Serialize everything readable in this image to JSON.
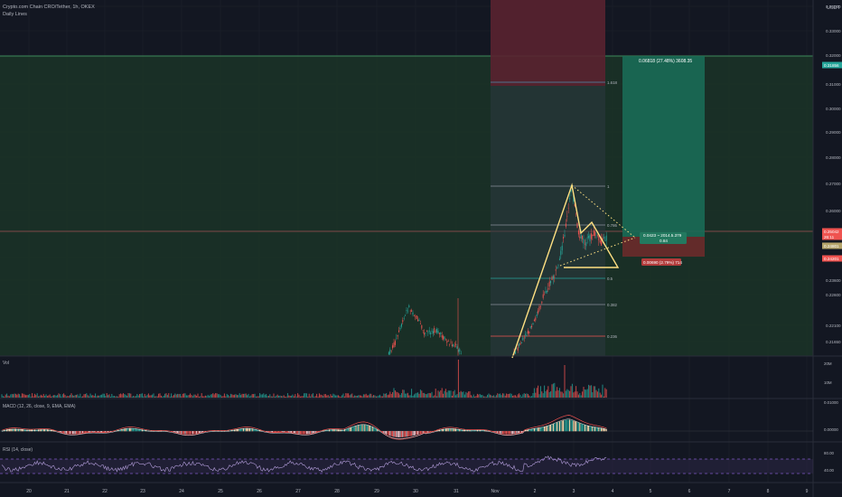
{
  "header": {
    "symbol_title": "Crypto.com Chain CRO/Tether, 1h, OKEX",
    "study_title": "Daily Lines",
    "currency": "USDT"
  },
  "panes": {
    "volume_title": "Vol",
    "macd_title": "MACD (12, 26, close, 9, EMA, EMA)",
    "rsi_title": "RSI (14, close)"
  },
  "chart_data": {
    "type": "candlestick",
    "symbol": "CRO/USDT",
    "timeframe": "1h",
    "exchange": "OKEX",
    "price_axis": {
      "ticks": [
        "0.34000",
        "0.33000",
        "0.32000",
        "0.31000",
        "0.30000",
        "0.29000",
        "0.28000",
        "0.27000",
        "0.26000",
        "0.25000",
        "0.24000",
        "0.23600",
        "0.22600",
        "0.22100",
        "0.21650"
      ],
      "badges": [
        {
          "label": "0.31856",
          "color": "#26a69a"
        },
        {
          "label": "0.25042",
          "color": "#ef5350"
        },
        {
          "label": "26:11",
          "color": "#ef5350"
        },
        {
          "label": "0.24801",
          "color": "#b5a46a"
        },
        {
          "label": "0.24201",
          "color": "#ef5350"
        }
      ]
    },
    "time_axis": [
      "20",
      "21",
      "22",
      "23",
      "24",
      "25",
      "26",
      "27",
      "28",
      "29",
      "30",
      "31",
      "Nov",
      "2",
      "3",
      "4",
      "5",
      "6",
      "7",
      "8",
      "9"
    ],
    "volume_axis": [
      "20M",
      "10M"
    ],
    "macd_axis": [
      "0.01000",
      "0.00000"
    ],
    "rsi_axis": [
      "80.00",
      "40.00"
    ],
    "fib_labels": [
      "1.618",
      "1",
      "0.786",
      "0.5",
      "0.382",
      "0.236"
    ],
    "position": {
      "target_label": "0.06818 (27.48%) 3608.35",
      "entry_label": "0.0423 ~ 2014.5.379",
      "ratio_label": "0.84",
      "stop_label": "0.00690 (2.79%) 714"
    },
    "colors": {
      "up": "#26a69a",
      "down": "#ef5350",
      "pattern": "#ffe082",
      "zone": "#1c3a2a"
    }
  }
}
